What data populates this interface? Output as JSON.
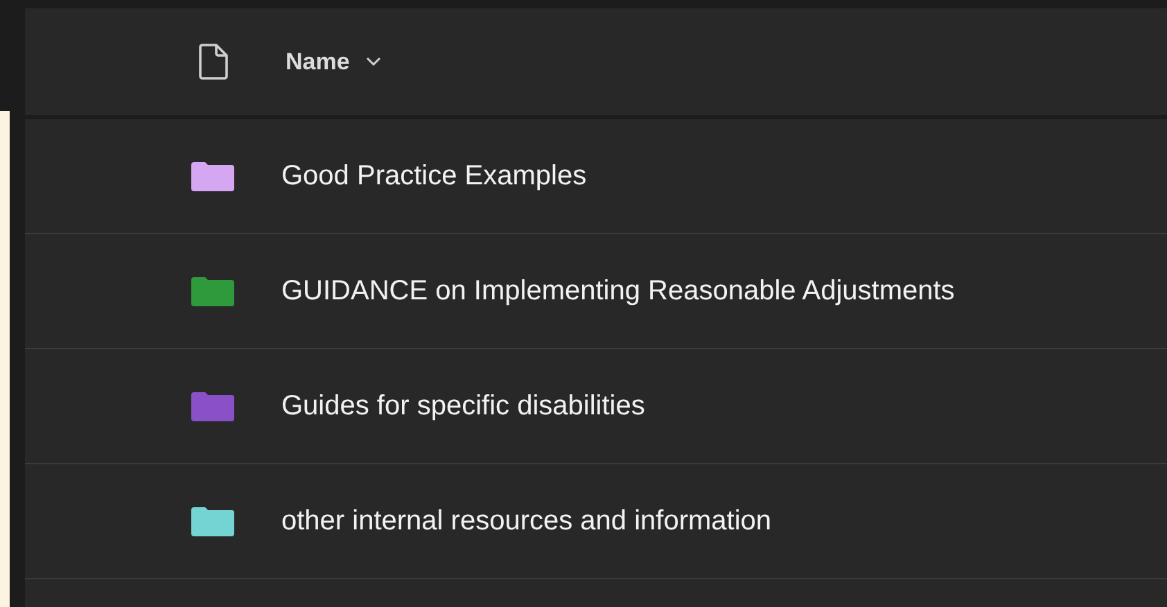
{
  "header": {
    "name_column": "Name"
  },
  "rows": [
    {
      "name": "Good Practice Examples",
      "color": "#d5a6f2"
    },
    {
      "name": "GUIDANCE on Implementing Reasonable Adjustments",
      "color": "#2e9a3c"
    },
    {
      "name": "Guides for specific disabilities",
      "color": "#8a50c8"
    },
    {
      "name": "other internal resources and information",
      "color": "#74d4d4"
    }
  ]
}
